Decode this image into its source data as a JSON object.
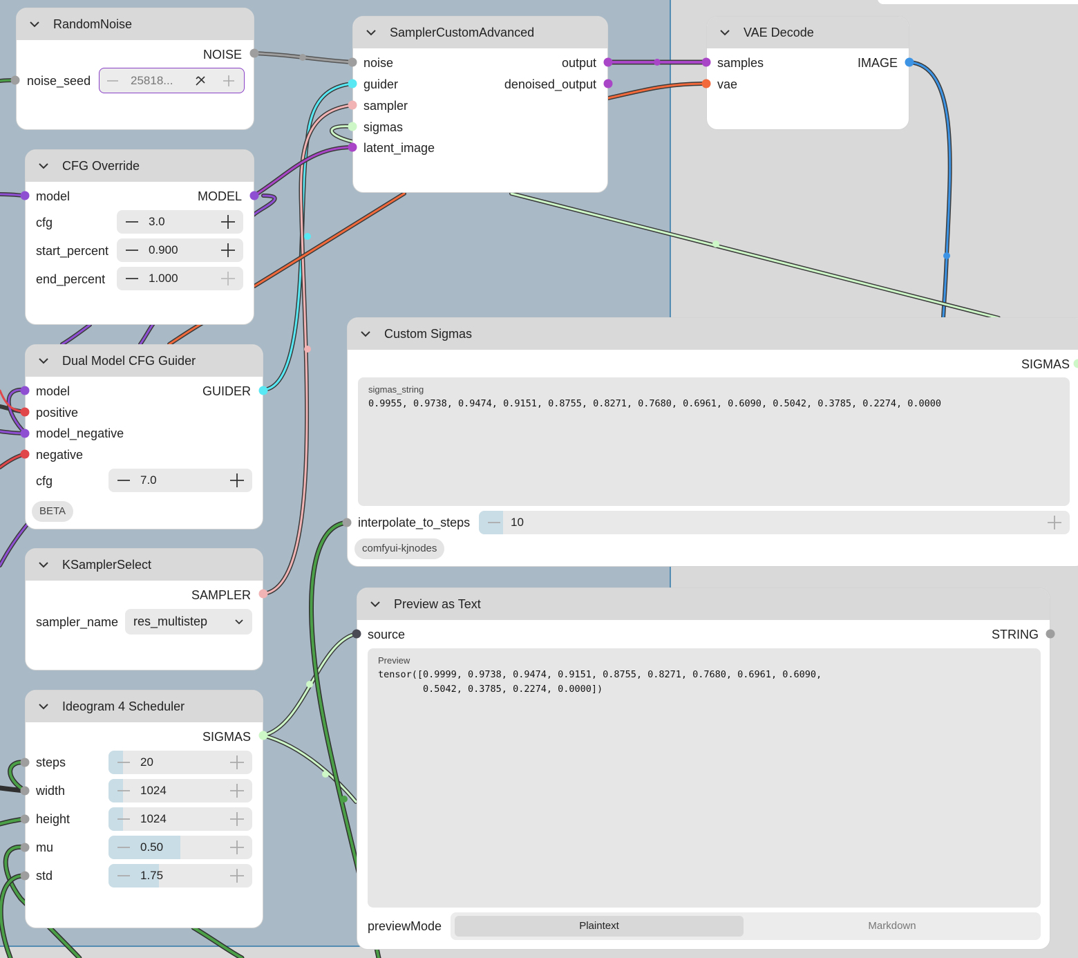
{
  "nodes": {
    "random_noise": {
      "title": "RandomNoise",
      "output": "NOISE",
      "widget_label": "noise_seed",
      "widget_value": "25818..."
    },
    "cfg_override": {
      "title": "CFG Override",
      "input": "model",
      "output": "MODEL",
      "widgets": [
        {
          "label": "cfg",
          "value": "3.0"
        },
        {
          "label": "start_percent",
          "value": "0.900"
        },
        {
          "label": "end_percent",
          "value": "1.000"
        }
      ]
    },
    "dual_guider": {
      "title": "Dual Model CFG Guider",
      "inputs": [
        "model",
        "positive",
        "model_negative",
        "negative"
      ],
      "output": "GUIDER",
      "widget_label": "cfg",
      "widget_value": "7.0",
      "badge": "BETA"
    },
    "ksampler_select": {
      "title": "KSamplerSelect",
      "output": "SAMPLER",
      "widget_label": "sampler_name",
      "widget_value": "res_multistep"
    },
    "ideogram": {
      "title": "Ideogram 4 Scheduler",
      "output": "SIGMAS",
      "widgets": [
        {
          "label": "steps",
          "value": "20",
          "fraction": 0.1
        },
        {
          "label": "width",
          "value": "1024",
          "fraction": 0.1
        },
        {
          "label": "height",
          "value": "1024",
          "fraction": 0.1
        },
        {
          "label": "mu",
          "value": "0.50",
          "fraction": 0.5
        },
        {
          "label": "std",
          "value": "1.75",
          "fraction": 0.35
        }
      ]
    },
    "sampler_custom": {
      "title": "SamplerCustomAdvanced",
      "inputs": [
        "noise",
        "guider",
        "sampler",
        "sigmas",
        "latent_image"
      ],
      "outputs": [
        "output",
        "denoised_output"
      ]
    },
    "vae_decode": {
      "title": "VAE Decode",
      "inputs": [
        "samples",
        "vae"
      ],
      "output": "IMAGE"
    },
    "custom_sigmas": {
      "title": "Custom Sigmas",
      "output": "SIGMAS",
      "textarea_label": "sigmas_string",
      "textarea_value": "0.9955, 0.9738, 0.9474, 0.9151, 0.8755, 0.8271, 0.7680, 0.6961, 0.6090, 0.5042, 0.3785, 0.2274, 0.0000",
      "widget_label": "interpolate_to_steps",
      "widget_value": "10",
      "badge": "comfyui-kjnodes"
    },
    "preview_text": {
      "title": "Preview as Text",
      "input": "source",
      "output": "STRING",
      "textarea_label": "Preview",
      "textarea_value": "tensor([0.9999, 0.9738, 0.9474, 0.9151, 0.8755, 0.8271, 0.7680, 0.6961, 0.6090,\n        0.5042, 0.3785, 0.2274, 0.0000])",
      "mode_label": "previewMode",
      "modes": [
        "Plaintext",
        "Markdown"
      ],
      "selected_mode": "Plaintext"
    }
  },
  "colors": {
    "group_bg": "#a9bac6",
    "canvas_bg": "#d9d9d9",
    "noise": "#9e9e9e",
    "model": "#8e4fd3",
    "guider": "#58e8f4",
    "sampler": "#f2b3b4",
    "sigmas": "#cdf7c7",
    "latent": "#a945c7",
    "vae": "#f26a3c",
    "image": "#3d94e5",
    "int": "#4b9f46",
    "conditioning": "#e0474a"
  }
}
